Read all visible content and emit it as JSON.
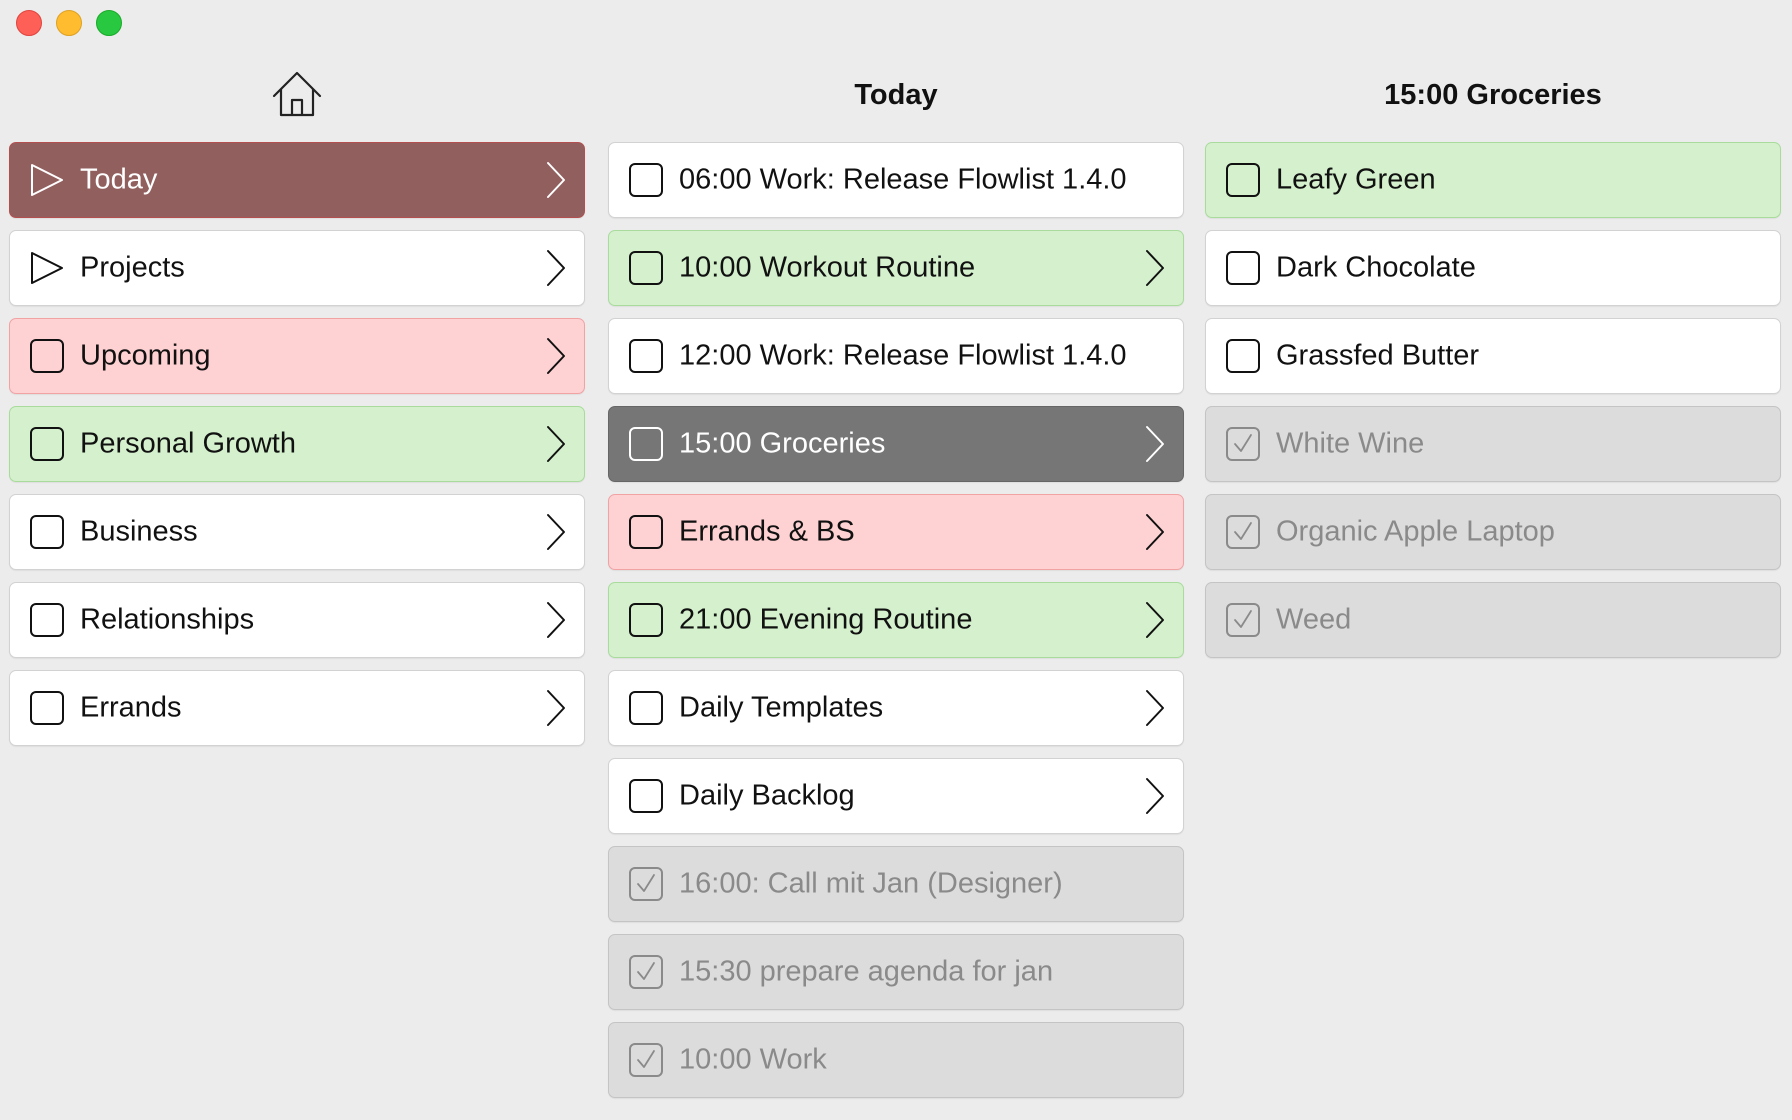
{
  "window": {
    "controls": [
      "close",
      "minimize",
      "zoom"
    ]
  },
  "colors": {
    "today_highlight": "#925f5f",
    "green_item": "#d4f0cc",
    "red_item": "#fed1d2",
    "selected_item": "#767676",
    "completed_item": "#dcdcdc"
  },
  "columns": {
    "home": {
      "header_icon": "home-icon",
      "items": [
        {
          "label": "Today",
          "icon": "play-triangle-icon",
          "style": "brown",
          "chevron": true
        },
        {
          "label": "Projects",
          "icon": "play-triangle-icon",
          "style": "white",
          "chevron": true
        },
        {
          "label": "Upcoming",
          "icon": "checkbox-icon",
          "style": "red",
          "chevron": true
        },
        {
          "label": "Personal Growth",
          "icon": "checkbox-icon",
          "style": "green",
          "chevron": true
        },
        {
          "label": "Business",
          "icon": "checkbox-icon",
          "style": "white",
          "chevron": true
        },
        {
          "label": "Relationships",
          "icon": "checkbox-icon",
          "style": "white",
          "chevron": true
        },
        {
          "label": "Errands",
          "icon": "checkbox-icon",
          "style": "white",
          "chevron": true
        }
      ]
    },
    "today": {
      "title": "Today",
      "items": [
        {
          "label": "06:00 Work: Release Flowlist 1.4.0",
          "icon": "checkbox-icon",
          "style": "white",
          "chevron": false
        },
        {
          "label": "10:00 Workout Routine",
          "icon": "checkbox-icon",
          "style": "green",
          "chevron": true
        },
        {
          "label": "12:00 Work: Release Flowlist 1.4.0",
          "icon": "checkbox-icon",
          "style": "white",
          "chevron": false
        },
        {
          "label": "15:00 Groceries",
          "icon": "checkbox-icon",
          "style": "selected",
          "chevron": true
        },
        {
          "label": "Errands & BS",
          "icon": "checkbox-icon",
          "style": "red",
          "chevron": true
        },
        {
          "label": "21:00 Evening Routine",
          "icon": "checkbox-icon",
          "style": "green",
          "chevron": true
        },
        {
          "label": "Daily Templates",
          "icon": "checkbox-icon",
          "style": "white",
          "chevron": true
        },
        {
          "label": "Daily Backlog",
          "icon": "checkbox-icon",
          "style": "white",
          "chevron": true
        },
        {
          "label": "16:00: Call mit Jan (Designer)",
          "icon": "checked-box-icon",
          "style": "done",
          "chevron": false
        },
        {
          "label": "15:30 prepare agenda for jan",
          "icon": "checked-box-icon",
          "style": "done",
          "chevron": false
        },
        {
          "label": "10:00 Work",
          "icon": "checked-box-icon",
          "style": "done",
          "chevron": false
        }
      ]
    },
    "groceries": {
      "title": "15:00 Groceries",
      "items": [
        {
          "label": "Leafy Green",
          "icon": "checkbox-icon",
          "style": "green",
          "chevron": false
        },
        {
          "label": "Dark Chocolate",
          "icon": "checkbox-icon",
          "style": "white",
          "chevron": false
        },
        {
          "label": "Grassfed Butter",
          "icon": "checkbox-icon",
          "style": "white",
          "chevron": false
        },
        {
          "label": "White Wine",
          "icon": "checked-box-icon",
          "style": "done",
          "chevron": false
        },
        {
          "label": "Organic Apple Laptop",
          "icon": "checked-box-icon",
          "style": "done",
          "chevron": false
        },
        {
          "label": "Weed",
          "icon": "checked-box-icon",
          "style": "done",
          "chevron": false
        }
      ]
    }
  }
}
